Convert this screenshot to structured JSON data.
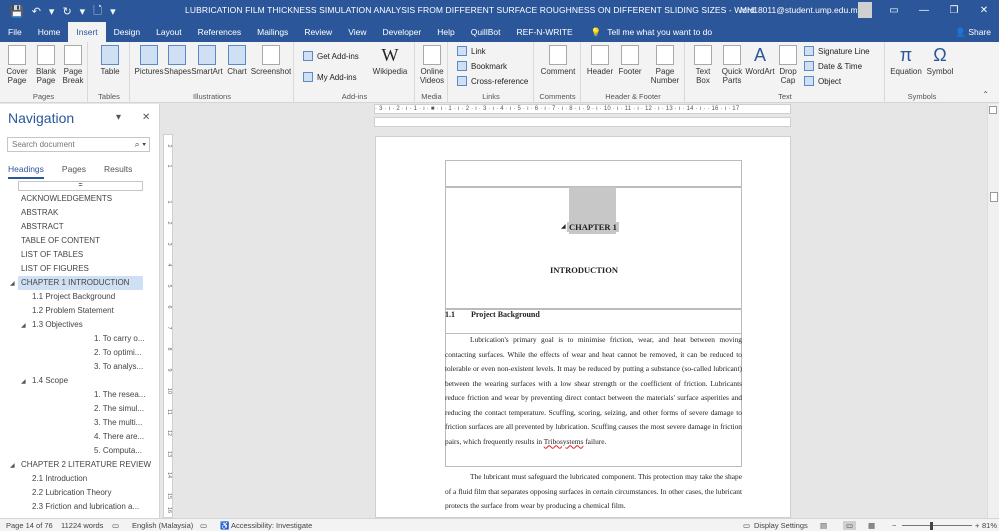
{
  "titlebar": {
    "doc_title": "LUBRICATION FILM THICKNESS SIMULATION ANALYSIS FROM DIFFERENT SURFACE ROUGHNESS ON DIFFERENT SLIDING SIZES  -  Word",
    "account": "MH18011@student.ump.edu.my",
    "qat": [
      "💾",
      "↶",
      "▾",
      "↻",
      "▾",
      "🗋",
      "▾"
    ]
  },
  "tabs": [
    "File",
    "Home",
    "Insert",
    "Design",
    "Layout",
    "References",
    "Mailings",
    "Review",
    "View",
    "Developer",
    "Help",
    "QuillBot",
    "REF-N-WRITE"
  ],
  "active_tab": "Insert",
  "tell_me": "Tell me what you want to do",
  "share": "Share",
  "ribbon": {
    "pages": {
      "label": "Pages",
      "buttons": [
        "Cover Page",
        "Blank Page",
        "Page Break"
      ]
    },
    "tables": {
      "label": "Tables",
      "buttons": [
        "Table"
      ]
    },
    "illustrations": {
      "label": "Illustrations",
      "buttons": [
        "Pictures",
        "Shapes",
        "SmartArt",
        "Chart",
        "Screenshot"
      ]
    },
    "addins": {
      "label": "Add-ins",
      "get": "Get Add-ins",
      "my": "My Add-ins",
      "wiki": "Wikipedia"
    },
    "media": {
      "label": "Media",
      "buttons": [
        "Online Videos"
      ]
    },
    "links": {
      "label": "Links",
      "items": [
        "Link",
        "Bookmark",
        "Cross-reference"
      ]
    },
    "comments": {
      "label": "Comments",
      "buttons": [
        "Comment"
      ]
    },
    "header_footer": {
      "label": "Header & Footer",
      "buttons": [
        "Header",
        "Footer",
        "Page Number"
      ]
    },
    "text": {
      "label": "Text",
      "buttons": [
        "Text Box",
        "Quick Parts",
        "WordArt",
        "Drop Cap"
      ],
      "small": [
        "Signature Line",
        "Date & Time",
        "Object"
      ]
    },
    "symbols": {
      "label": "Symbols",
      "buttons": [
        "Equation",
        "Symbol"
      ]
    }
  },
  "nav": {
    "title": "Navigation",
    "search_placeholder": "Search document",
    "tabs": [
      "Headings",
      "Pages",
      "Results"
    ],
    "blank": "=",
    "items": [
      {
        "text": "ACKNOWLEDGEMENTS"
      },
      {
        "text": "ABSTRAK"
      },
      {
        "text": "ABSTRACT"
      },
      {
        "text": "TABLE OF CONTENT"
      },
      {
        "text": "LIST OF TABLES"
      },
      {
        "text": "LIST OF FIGURES"
      },
      {
        "text": "CHAPTER 1     INTRODUCTION"
      },
      {
        "text": "1.1 Project Background"
      },
      {
        "text": "1.2 Problem Statement"
      },
      {
        "text": "1.3 Objectives"
      },
      {
        "text": "1. To carry o..."
      },
      {
        "text": "2. To optimi..."
      },
      {
        "text": "3. To analys..."
      },
      {
        "text": "1.4 Scope"
      },
      {
        "text": "1. The resea..."
      },
      {
        "text": "2. The simul..."
      },
      {
        "text": "3. The multi..."
      },
      {
        "text": "4. There are..."
      },
      {
        "text": "5. Computa..."
      },
      {
        "text": "CHAPTER 2     LITERATURE REVIEW"
      },
      {
        "text": "2.1 Introduction"
      },
      {
        "text": "2.2 Lubrication Theory"
      },
      {
        "text": "2.3 Friction and lubrication a..."
      }
    ]
  },
  "ruler": "· 3 · ı · 2 · ı · 1 · ı · ■ · ı · 1 · ı · 2 · ı · 3 · ı · 4 · ı · 5 · ı · 6 · ı · 7 · ı · 8 · ı · 9 · ı · 10 · ı · 11 · ı · 12 · ı · 13 · ı · 14 · ı ·  · 16 · ı · 17",
  "vruler_marks": [
    "2",
    "1",
    "1",
    "2",
    "3",
    "4",
    "5",
    "6",
    "7",
    "8",
    "9",
    "10",
    "11",
    "12",
    "13",
    "14",
    "15",
    "16"
  ],
  "document": {
    "chapter": "CHAPTER 1",
    "heading": "INTRODUCTION",
    "section_num": "1.1",
    "section_title": "Project Background",
    "para1": "Lubrication's primary goal is to minimise friction, wear, and heat between moving contacting surfaces. While the effects of wear and heat cannot be removed, it can be reduced to tolerable or even non-existent levels. It may be reduced by putting a substance (so-called lubricant) between the wearing surfaces with a low shear strength or the coefficient of friction. Lubricants reduce friction and wear by preventing direct contact between the materials' surface asperities and reducing the contact temperature. Scuffing, scoring, seizing, and other forms of severe damage to friction surfaces are all prevented by lubrication. Scuffing causes the most severe damage in friction pairs, which frequently results in ",
    "para1_err": "Tribosystems",
    "para1_end": " failure.",
    "para2": "The lubricant must safeguard the lubricated component. This protection may take the shape of a fluid film that separates opposing surfaces in certain circumstances. In other cases, the lubricant protects the surface from wear by producing a chemical film."
  },
  "status": {
    "page": "Page 14 of 76",
    "words": "11224 words",
    "language": "English (Malaysia)",
    "accessibility": "Accessibility: Investigate",
    "display": "Display Settings",
    "zoom": "81%"
  }
}
